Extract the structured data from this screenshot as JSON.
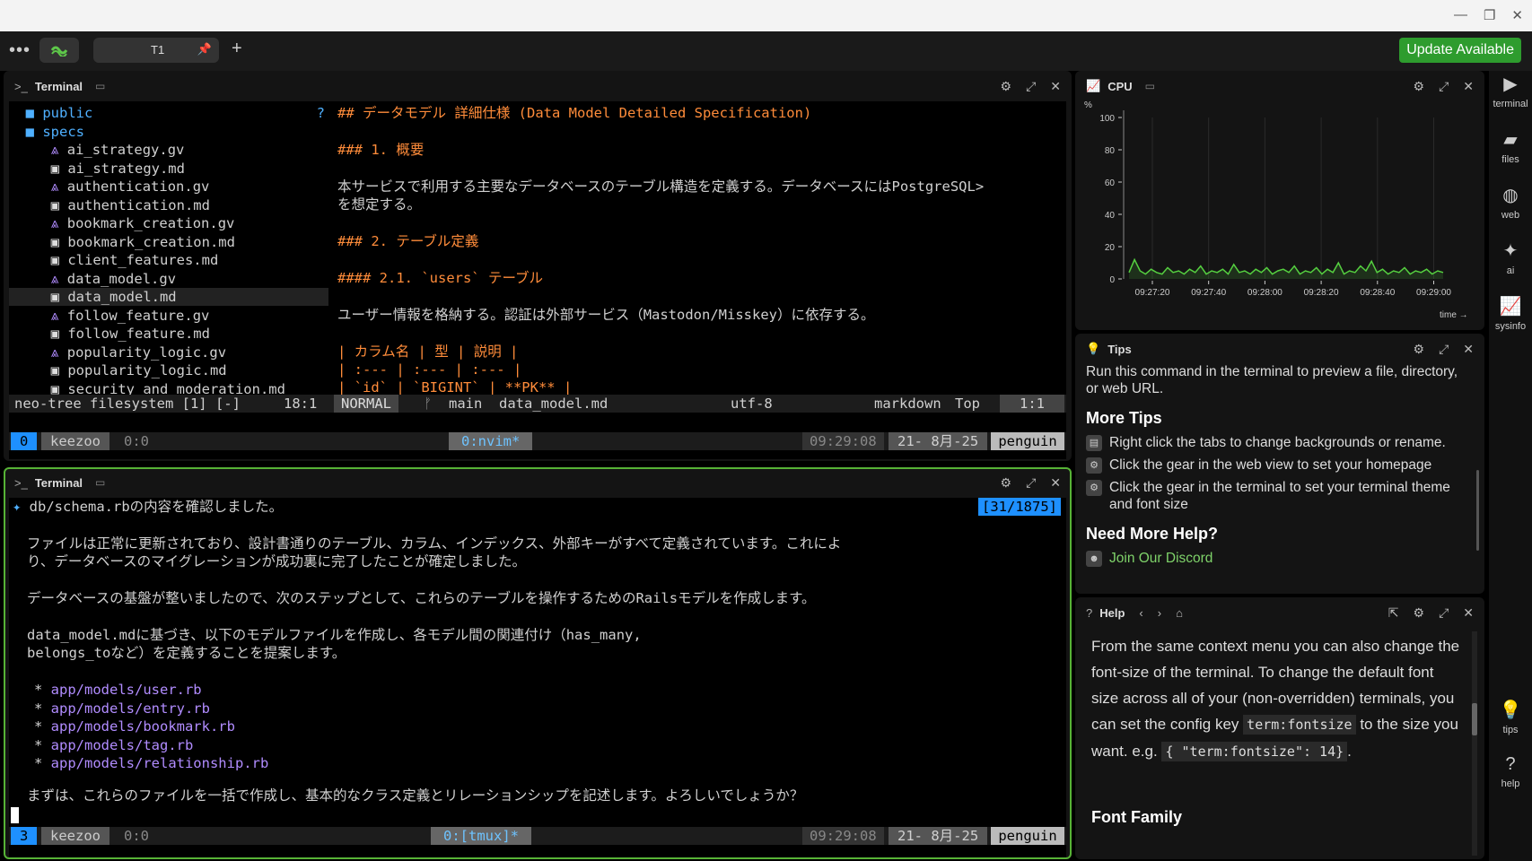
{
  "tabbar": {
    "tab_label": "T1",
    "update_label": "Update Available"
  },
  "terminal1": {
    "title": "Terminal",
    "tree": [
      {
        "name": "public",
        "type": "folder",
        "extra": "?"
      },
      {
        "name": "specs",
        "type": "folder-open"
      },
      {
        "name": "ai_strategy.gv",
        "type": "gv"
      },
      {
        "name": "ai_strategy.md",
        "type": "md"
      },
      {
        "name": "authentication.gv",
        "type": "gv"
      },
      {
        "name": "authentication.md",
        "type": "md"
      },
      {
        "name": "bookmark_creation.gv",
        "type": "gv"
      },
      {
        "name": "bookmark_creation.md",
        "type": "md"
      },
      {
        "name": "client_features.md",
        "type": "md"
      },
      {
        "name": "data_model.gv",
        "type": "gv"
      },
      {
        "name": "data_model.md",
        "type": "md",
        "selected": true
      },
      {
        "name": "follow_feature.gv",
        "type": "gv"
      },
      {
        "name": "follow_feature.md",
        "type": "md"
      },
      {
        "name": "popularity_logic.gv",
        "type": "gv"
      },
      {
        "name": "popularity_logic.md",
        "type": "md"
      },
      {
        "name": "security_and_moderation.md",
        "type": "md"
      }
    ],
    "editor": {
      "l1": "## データモデル 詳細仕様 (Data Model Detailed Specification)",
      "l2": "### 1. 概要",
      "l3a": "本サービスで利用する主要なデータベースのテーブル構造を定義する。データベースにはPostgreSQL>",
      "l3b": "を想定する。",
      "l4": "### 2. テーブル定義",
      "l5": "#### 2.1. `users` テーブル",
      "l6": "ユーザー情報を格納する。認証は外部サービス（Mastodon/Misskey）に依存する。",
      "l7": "| カラム名 | 型 | 説明 |",
      "l8": "| :--- | :--- | :--- |",
      "l9": "| `id` | `BIGINT` | **PK** |"
    },
    "status": {
      "tree": "neo-tree filesystem [1] [-]",
      "tree_pos": "18:1",
      "mode": "NORMAL",
      "branch": "main",
      "file": "data_model.md",
      "enc": "utf-8",
      "ft": "markdown",
      "top": "Top",
      "pos": "1:1"
    },
    "tmux": {
      "win": "0",
      "session": "keezoo",
      "pane": "0:0",
      "window": "0:nvim*",
      "time": "09:29:08",
      "date": "21- 8月-25",
      "host": "penguin"
    }
  },
  "terminal2": {
    "title": "Terminal",
    "counter": "[31/1875]",
    "l1": "db/schema.rbの内容を確認しました。",
    "p1a": "ファイルは正常に更新されており、設計書通りのテーブル、カラム、インデックス、外部キーがすべて定義されています。これによ",
    "p1b": "り、データベースのマイグレーションが成功裏に完了したことが確定しました。",
    "p2": "データベースの基盤が整いましたので、次のステップとして、これらのテーブルを操作するためのRailsモデルを作成します。",
    "p3a": "data_model.mdに基づき、以下のモデルファイルを作成し、各モデル間の関連付け（has_many,",
    "p3b": "belongs_toなど）を定義することを提案します。",
    "files": [
      "app/models/user.rb",
      "app/models/entry.rb",
      "app/models/bookmark.rb",
      "app/models/tag.rb",
      "app/models/relationship.rb"
    ],
    "p4": "まずは、これらのファイルを一括で作成し、基本的なクラス定義とリレーションシップを記述します。よろしいでしょうか？",
    "tmux": {
      "win": "3",
      "session": "keezoo",
      "pane": "0:0",
      "window": "0:[tmux]*",
      "time": "09:29:08",
      "date": "21- 8月-25",
      "host": "penguin"
    }
  },
  "cpu": {
    "title": "CPU",
    "unit": "%",
    "yticks": [
      "100",
      "80",
      "60",
      "40",
      "20",
      "0"
    ],
    "xticks": [
      "09:27:20",
      "09:27:40",
      "09:28:00",
      "09:28:20",
      "09:28:40",
      "09:29:00"
    ],
    "xlabel": "time →"
  },
  "chart_data": {
    "type": "line",
    "ylim": [
      0,
      100
    ],
    "xlabel": "time",
    "ylabel": "%",
    "x": [
      "09:27:20",
      "09:27:40",
      "09:28:00",
      "09:28:20",
      "09:28:40",
      "09:29:00"
    ],
    "series": [
      {
        "values": [
          4,
          12,
          5,
          3,
          6,
          4,
          3,
          7,
          4,
          5,
          3,
          6,
          4,
          8,
          3,
          5,
          4,
          6,
          3,
          9,
          4,
          5,
          3,
          6,
          4,
          7,
          3,
          5,
          6,
          4,
          8,
          3,
          5,
          4,
          7,
          3,
          6,
          4,
          10,
          3,
          5,
          4,
          8,
          5,
          11,
          4,
          6,
          3,
          5,
          4,
          7,
          3,
          5,
          4,
          6,
          3,
          5,
          4
        ]
      }
    ],
    "grid": true,
    "color": "#55d040"
  },
  "tips": {
    "title": "Tips",
    "intro": "Run this command in the terminal to preview a file, directory, or web URL.",
    "more_title": "More Tips",
    "items": [
      "Right click the tabs to change backgrounds or rename.",
      "Click the gear in the web view to set your homepage",
      "Click the gear in the terminal to set your terminal theme and font size"
    ],
    "help_title": "Need More Help?",
    "discord": "Join Our Discord"
  },
  "help": {
    "title": "Help",
    "p1": "From the same context menu you can also change the font-size of the terminal. To change the default font size across all of your (non-overridden) terminals, you can set the config key",
    "code1": "term:fontsize",
    "p2": "to the size you want. e.g.",
    "code2": "{ \"term:fontsize\": 14}",
    "p3": ".",
    "font_family": "Font Family"
  },
  "sidebar": [
    {
      "label": "terminal",
      "icon": "terminal-icon"
    },
    {
      "label": "files",
      "icon": "folder-icon"
    },
    {
      "label": "web",
      "icon": "globe-icon"
    },
    {
      "label": "ai",
      "icon": "sparkle-icon"
    },
    {
      "label": "sysinfo",
      "icon": "chart-icon"
    },
    {
      "label": "tips",
      "icon": "lightbulb-icon"
    },
    {
      "label": "help",
      "icon": "help-icon"
    }
  ]
}
